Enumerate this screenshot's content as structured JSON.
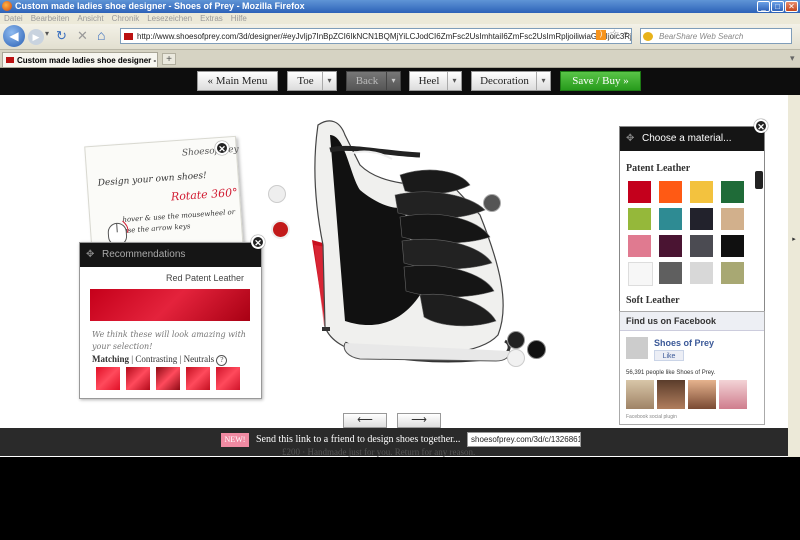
{
  "browser": {
    "window_title": "Custom made ladies shoe designer - Shoes of Prey - Mozilla Firefox",
    "menu": [
      "Datei",
      "Bearbeiten",
      "Ansicht",
      "Chronik",
      "Lesezeichen",
      "Extras",
      "Hilfe"
    ],
    "url": "http://www.shoesofprey.com/3d/designer/#eyJvIjp7InBpZCI6IkNCN1BQMjYiLCJodCI6ZmFsc2UsImhtaiI6ZmFsc2UsImRpljoiliwiaGx0Ijoic3Rj",
    "search_placeholder": "BearShare Web Search",
    "tab_label": "Custom made ladies shoe designer - ..."
  },
  "toolbar": {
    "main_menu": "« Main Menu",
    "toe": "Toe",
    "back": "Back",
    "heel": "Heel",
    "decoration": "Decoration",
    "save_buy": "Save / Buy »"
  },
  "note": {
    "design_text": "Design your own shoes!",
    "rotate": "Rotate 360°",
    "hint": "hover & use the mousewheel or use the arrow keys"
  },
  "recommendations": {
    "header": "Recommendations",
    "material": "Red Patent Leather",
    "message": "We think these will look amazing with your selection!",
    "tab_matching": "Matching",
    "tab_contrasting": "Contrasting",
    "tab_neutrals": "Neutrals",
    "help": "?",
    "swatches": [
      "#e01027",
      "#b30a1a",
      "#8f0a14",
      "#c41021",
      "#d0142a"
    ]
  },
  "materials": {
    "header": "Choose a material...",
    "section1": "Patent Leather",
    "section2": "Soft Leather",
    "swatches": [
      "#c4001c",
      "#ff5a14",
      "#f3c23e",
      "#1f6b38",
      "#95b83a",
      "#2e8b93",
      "#22222c",
      "#d2b08c",
      "#e07a90",
      "#4a1432",
      "#4b4b52",
      "#101010",
      "#f7f7f7",
      "#5f5f5f",
      "#d8d8d8",
      "#a8a873"
    ]
  },
  "facebook": {
    "header": "Find us on Facebook",
    "brand": "Shoes of Prey",
    "like": "Like",
    "count_text": "56,391 people like Shoes of Prey.",
    "plugin": "Facebook social plugin"
  },
  "bottom": {
    "new": "NEW!",
    "send_text": "Send this link to a friend to design shoes together...",
    "share_url": "shoesofprey.com/3d/c/1326861",
    "footnote": "£200 · Handmade just for you. Return for any reason."
  },
  "icons": [
    "firefox-icon",
    "back-icon",
    "forward-icon",
    "reload-icon",
    "stop-icon",
    "home-icon",
    "rss-icon",
    "star-icon",
    "search-engine-icon",
    "close-icon",
    "move-icon",
    "arrow-left-icon",
    "arrow-right-icon"
  ]
}
